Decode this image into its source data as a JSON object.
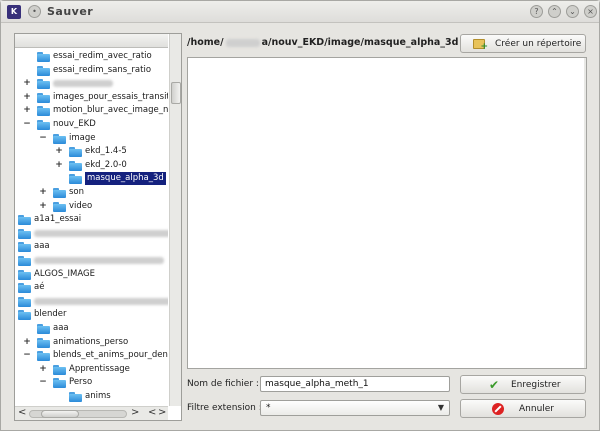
{
  "window": {
    "title": "Sauver",
    "app_icon": "K",
    "buttons": [
      "?",
      "⌃",
      "⌄",
      "×"
    ]
  },
  "tree": {
    "rows": [
      {
        "label": "essai_redim_avec_ratio",
        "blur": false
      },
      {
        "label": "essai_redim_sans_ratio",
        "blur": false
      },
      {
        "label": "",
        "blur": true
      },
      {
        "label": "images_pour_essais_transit",
        "blur": false
      },
      {
        "label": "motion_blur_avec_image_n",
        "blur": false
      },
      {
        "label": "nouv_EKD",
        "blur": false
      },
      {
        "label": "image",
        "blur": false
      },
      {
        "label": "ekd_1.4-5",
        "blur": false
      },
      {
        "label": "ekd_2.0-0",
        "blur": false
      },
      {
        "label": "masque_alpha_3d",
        "blur": false
      },
      {
        "label": "son",
        "blur": false
      },
      {
        "label": "video",
        "blur": false
      },
      {
        "label": "a1a1_essai",
        "blur": false
      },
      {
        "label": "",
        "blur": true
      },
      {
        "label": "aaa",
        "blur": false
      },
      {
        "label": "",
        "blur": true
      },
      {
        "label": "ALGOS_IMAGE",
        "blur": false
      },
      {
        "label": "aé",
        "blur": false
      },
      {
        "label": "",
        "blur": true
      },
      {
        "label": "blender",
        "blur": false
      },
      {
        "label": "aaa",
        "blur": false
      },
      {
        "label": "animations_perso",
        "blur": false
      },
      {
        "label": "blends_et_anims_pour_den",
        "blur": false
      },
      {
        "label": "Apprentissage",
        "blur": false
      },
      {
        "label": "Perso",
        "blur": false
      },
      {
        "label": "anims",
        "blur": false
      }
    ],
    "selected": "masque_alpha_3d",
    "scroll_arrows": [
      "<",
      ">",
      "<",
      ">"
    ]
  },
  "path": {
    "prefix": "/home/",
    "suffix": "a/nouv_EKD/image/masque_alpha_3d"
  },
  "create_dir_button": "Créer un répertoire",
  "filename": {
    "label": "Nom de fichier :",
    "value": "masque_alpha_meth_1"
  },
  "filter": {
    "label": "Filtre extension :",
    "value": "*",
    "arrow": "▼"
  },
  "save_button": "Enregistrer",
  "cancel_button": "Annuler",
  "colors": {
    "selection": "#14217e",
    "folder": "#2b8ad8",
    "save_check": "#3a9a2a",
    "cancel_red": "#dd2222"
  }
}
